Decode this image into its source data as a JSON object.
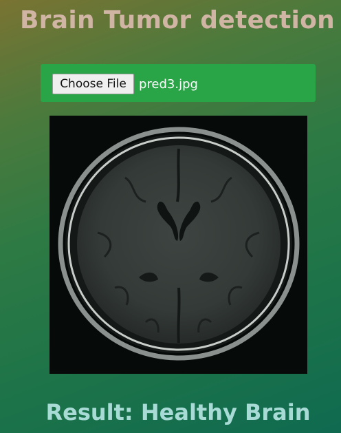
{
  "header": {
    "title": "Brain Tumor detection"
  },
  "upload": {
    "button_label": "Choose File",
    "file_name": "pred3.jpg"
  },
  "result": {
    "text": "Result: Healthy Brain"
  },
  "colors": {
    "title": "#d0b4a4",
    "upload_bar": "#29a447",
    "result": "#a9dbd6",
    "scan_background": "#060a08"
  },
  "icons": {
    "scan_image": "brain-mri-scan"
  }
}
